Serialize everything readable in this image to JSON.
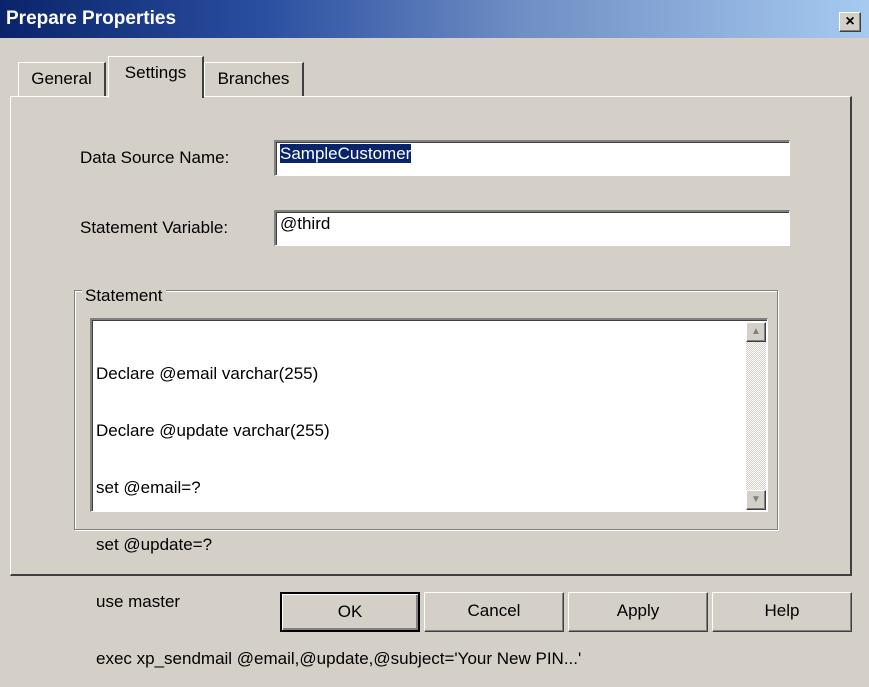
{
  "window": {
    "title": "Prepare Properties",
    "close_label": "×"
  },
  "tabs": [
    {
      "label": "General"
    },
    {
      "label": "Settings",
      "active": true
    },
    {
      "label": "Branches"
    }
  ],
  "form": {
    "data_source_label": "Data Source Name:",
    "data_source_value": "SampleCustomer",
    "statement_variable_label": "Statement Variable:",
    "statement_variable_value": "@third"
  },
  "statement": {
    "group_label": "Statement",
    "lines": [
      "Declare @email varchar(255)",
      "Declare @update varchar(255)",
      "set @email=?",
      "set @update=?",
      "use master",
      "exec xp_sendmail @email,@update,@subject='Your New PIN...'"
    ]
  },
  "buttons": {
    "ok": "OK",
    "cancel": "Cancel",
    "apply": "Apply",
    "help": "Help"
  },
  "icons": {
    "scroll_up": "▲",
    "scroll_down": "▼"
  },
  "colors": {
    "title_bar_start": "#0a246a",
    "title_bar_end": "#a6caf0",
    "dialog_face": "#d4d0c8",
    "selection": "#0a246a"
  }
}
